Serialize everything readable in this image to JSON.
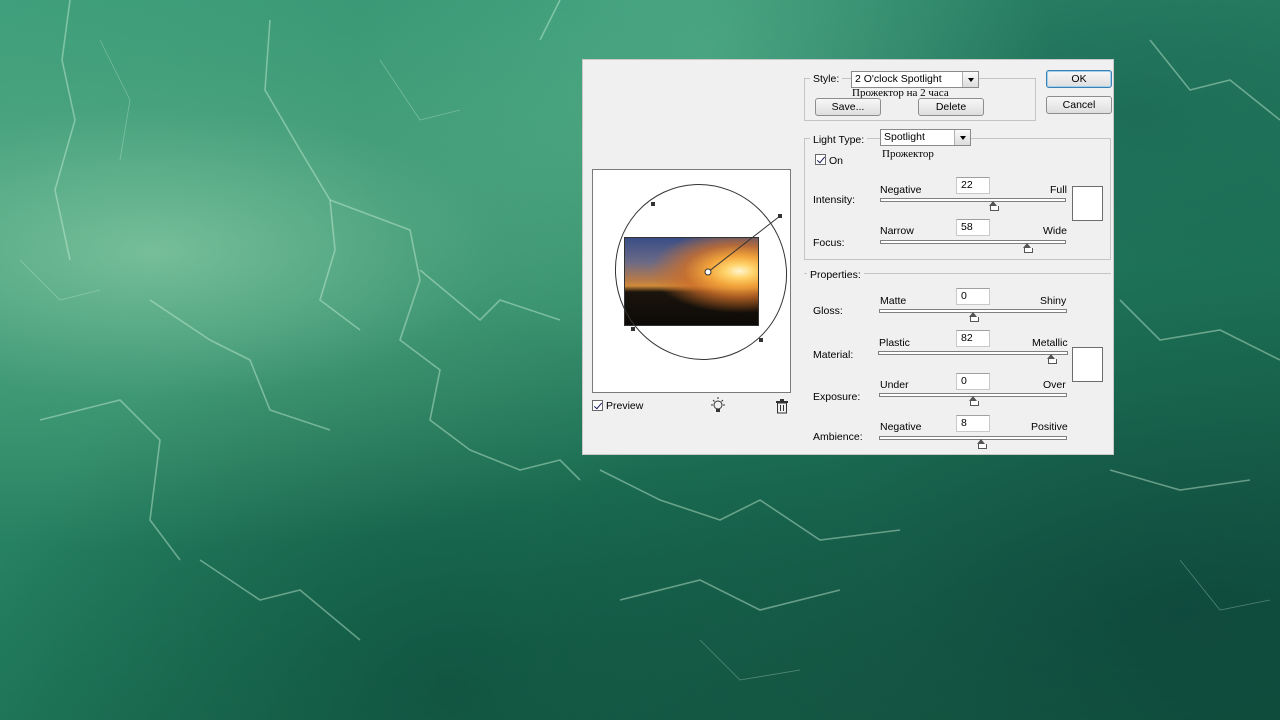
{
  "dialog": {
    "style": {
      "label": "Style:",
      "selected": "2 O'clock Spotlight",
      "note": "Прожектор на 2 часа",
      "save_label": "Save...",
      "delete_label": "Delete"
    },
    "ok_label": "OK",
    "cancel_label": "Cancel",
    "light_type": {
      "label": "Light Type:",
      "selected": "Spotlight",
      "note": "Прожектор",
      "on_label": "On",
      "on_checked": true,
      "intensity": {
        "label": "Intensity:",
        "left": "Negative",
        "right": "Full",
        "value": "22",
        "fraction": 0.61
      },
      "focus": {
        "label": "Focus:",
        "left": "Narrow",
        "right": "Wide",
        "value": "58",
        "fraction": 0.79
      },
      "swatch_color": "#ffffff"
    },
    "properties": {
      "label": "Properties:",
      "gloss": {
        "label": "Gloss:",
        "left": "Matte",
        "right": "Shiny",
        "value": "0",
        "fraction": 0.5
      },
      "material": {
        "label": "Material:",
        "left": "Plastic",
        "right": "Metallic",
        "value": "82",
        "fraction": 0.91
      },
      "exposure": {
        "label": "Exposure:",
        "left": "Under",
        "right": "Over",
        "value": "0",
        "fraction": 0.5
      },
      "ambience": {
        "label": "Ambience:",
        "left": "Negative",
        "right": "Positive",
        "value": "8",
        "fraction": 0.54
      },
      "swatch_color": "#ffffff"
    },
    "preview": {
      "label": "Preview",
      "checked": true,
      "new_light_icon": "light-bulb-icon",
      "delete_icon": "trash-icon"
    }
  }
}
